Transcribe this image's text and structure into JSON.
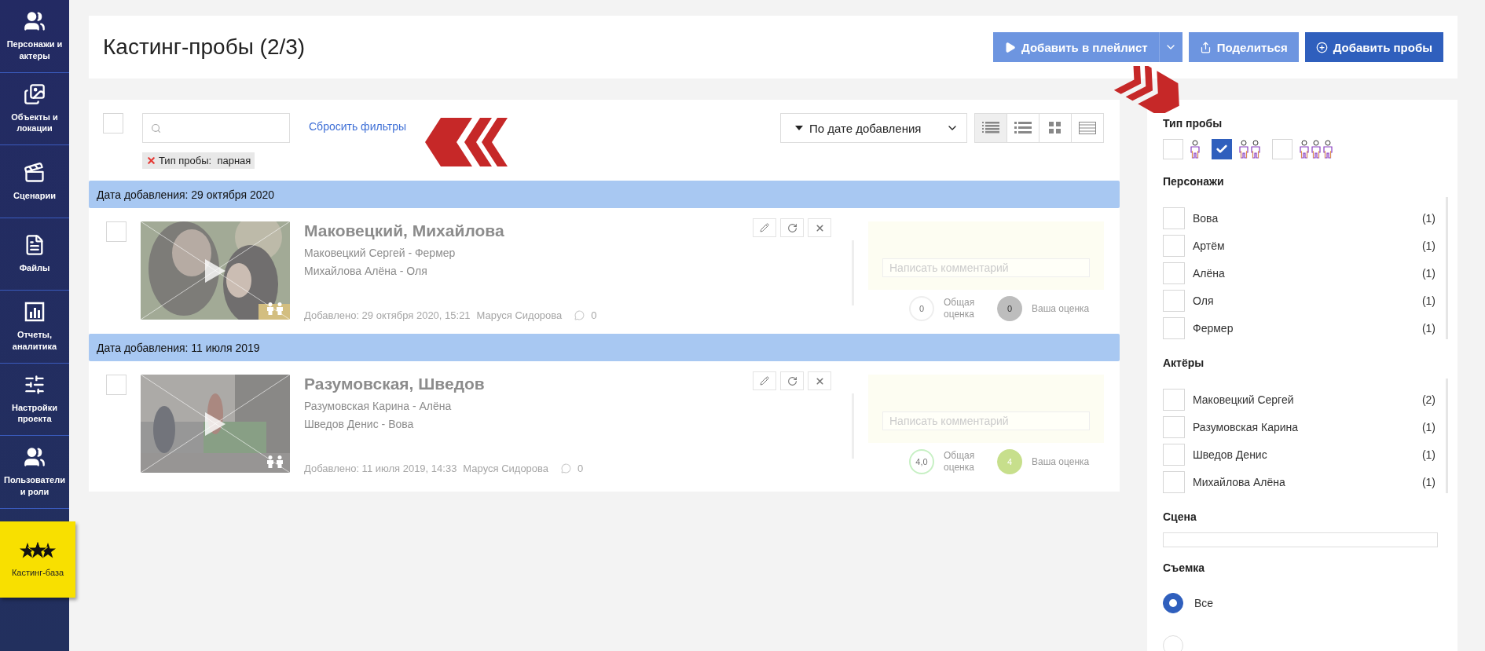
{
  "sidebar": [
    {
      "label": "Персонажи и актеры",
      "selected": false
    },
    {
      "label": "Объекты и локации",
      "selected": false
    },
    {
      "label": "Сценарии",
      "selected": false
    },
    {
      "label": "Файлы",
      "selected": false
    },
    {
      "label": "Отчеты, аналитика",
      "selected": false
    },
    {
      "label": "Настройки проекта",
      "selected": false
    },
    {
      "label": "Пользователи и роли",
      "selected": false
    },
    {
      "label": "Кастинг-база",
      "selected": true
    }
  ],
  "header": {
    "title": "Кастинг-пробы (2/3)",
    "buttons": [
      {
        "label": "Добавить в плейлист",
        "kind": "playlist"
      },
      {
        "label": "Поделиться",
        "kind": "share"
      },
      {
        "label": "Добавить пробы",
        "kind": "add"
      }
    ]
  },
  "toolbar": {
    "select_all_checked": false,
    "reset_link": "Сбросить фильтры",
    "filter_chips": [
      "Тип пробы:  парная"
    ],
    "sort": "По дате добавления",
    "view_modes": [
      {
        "kind": "dense",
        "selected": true
      },
      {
        "kind": "list",
        "selected": false
      },
      {
        "kind": "grid",
        "selected": false
      },
      {
        "kind": "table",
        "selected": false
      }
    ]
  },
  "groups": [
    {
      "header": "Дата добавления: 29 октября 2020",
      "items": [
        {
          "title": "Маковецкий, Михайлова",
          "roles": [
            "Маковецкий Сергей - Фермер",
            "Михайлова Алёна - Оля"
          ],
          "added": "Добавлено: 29 октября 2020, 15:21",
          "author": "Маруся Сидорова",
          "comments": "0",
          "comment_placeholder": "Написать комментарий",
          "overall": "0",
          "overall_label": "Общая оценка",
          "own": "0",
          "own_label": "Ваша оценка",
          "rated": false,
          "checked": false
        }
      ]
    },
    {
      "header": "Дата добавления: 11 июля 2019",
      "items": [
        {
          "title": "Разумовская, Шведов",
          "roles": [
            "Разумовская Карина - Алёна",
            "Шведов Денис - Вова"
          ],
          "added": "Добавлено: 11 июля 2019, 14:33",
          "author": "Маруся Сидорова",
          "comments": "0",
          "comment_placeholder": "Написать комментарий",
          "overall": "4,0",
          "overall_label": "Общая оценка",
          "own": "4",
          "own_label": "Ваша оценка",
          "rated": true,
          "checked": false
        }
      ]
    }
  ],
  "filters": {
    "type": {
      "title": "Тип пробы",
      "options": [
        {
          "kind": "single",
          "checked": false
        },
        {
          "kind": "pair",
          "checked": true
        },
        {
          "kind": "trio",
          "checked": false
        }
      ]
    },
    "characters": {
      "title": "Персонажи",
      "items": [
        {
          "label": "Вова",
          "count": "(1)",
          "checked": false
        },
        {
          "label": "Артём",
          "count": "(1)",
          "checked": false
        },
        {
          "label": "Алёна",
          "count": "(1)",
          "checked": false
        },
        {
          "label": "Оля",
          "count": "(1)",
          "checked": false
        },
        {
          "label": "Фермер",
          "count": "(1)",
          "checked": false
        }
      ]
    },
    "actors": {
      "title": "Актёры",
      "items": [
        {
          "label": "Маковецкий Сергей",
          "count": "(2)",
          "checked": false
        },
        {
          "label": "Разумовская Карина",
          "count": "(1)",
          "checked": false
        },
        {
          "label": "Шведов Денис",
          "count": "(1)",
          "checked": false
        },
        {
          "label": "Михайлова Алёна",
          "count": "(1)",
          "checked": false
        }
      ]
    },
    "scene": {
      "title": "Сцена"
    },
    "shooting": {
      "title": "Съемка",
      "options": [
        {
          "label": "Все",
          "selected": true
        },
        {
          "selected": false
        }
      ]
    }
  }
}
